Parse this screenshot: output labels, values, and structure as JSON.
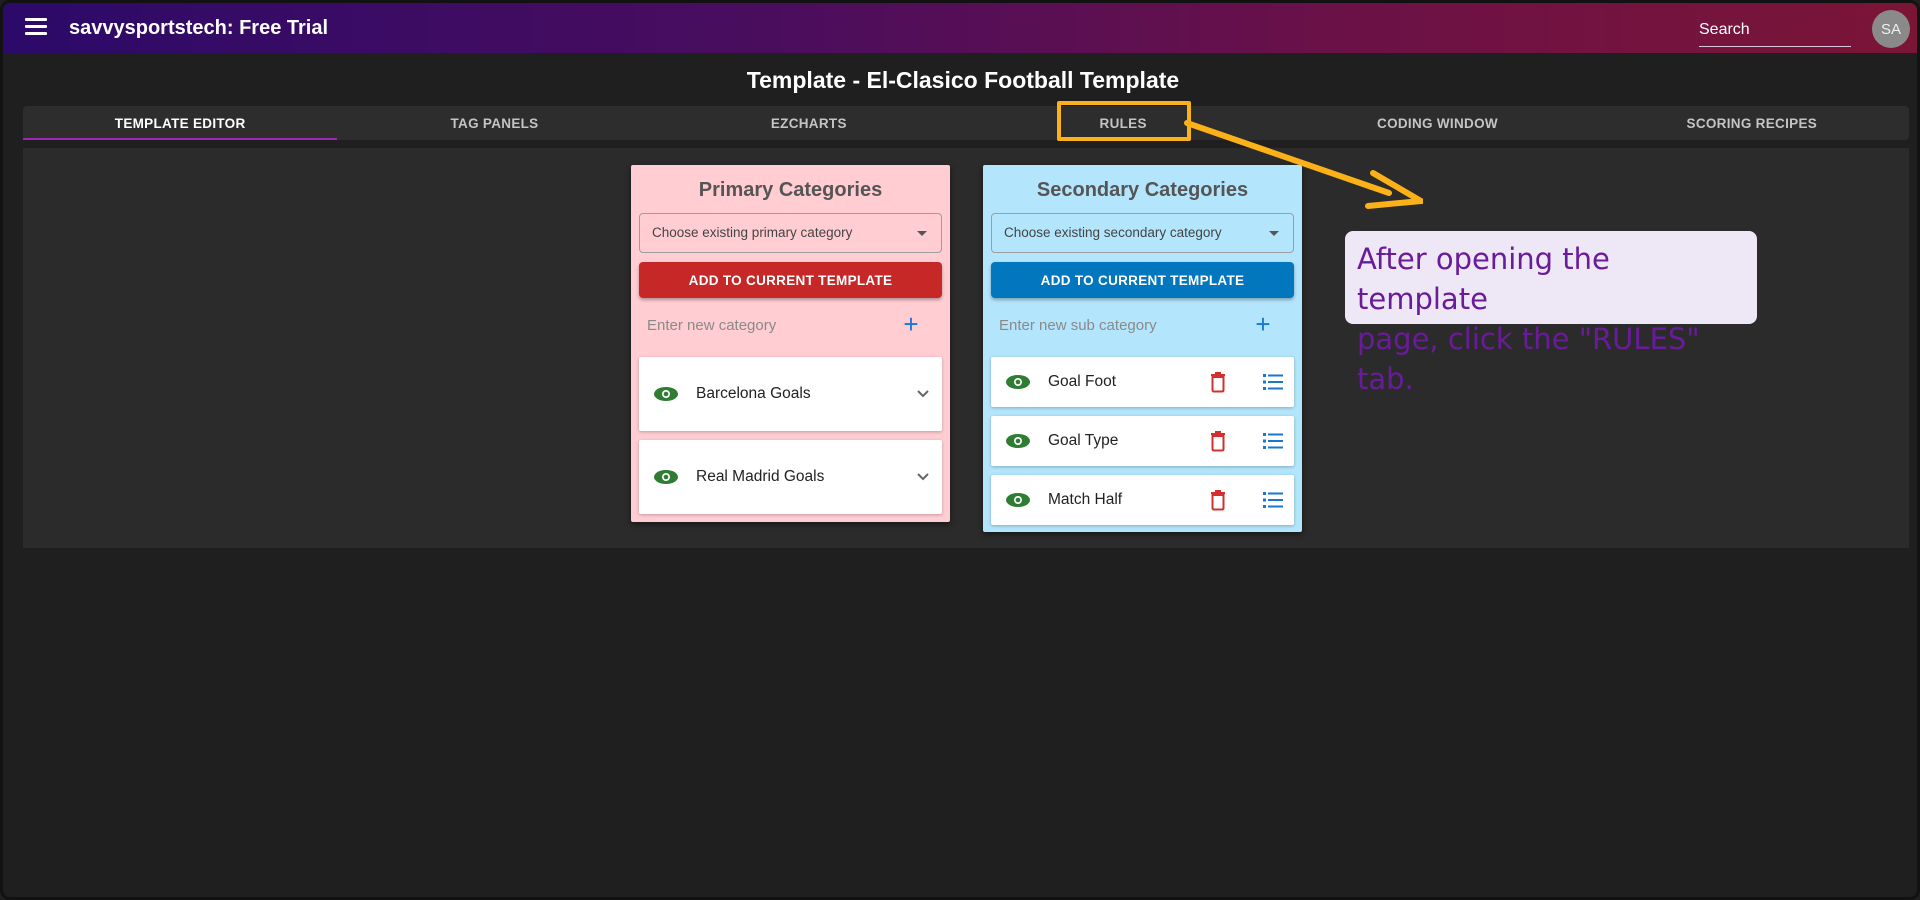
{
  "app": {
    "title": "savvysportstech: Free Trial",
    "search_placeholder": "Search",
    "avatar_initials": "SA"
  },
  "page": {
    "title": "Template - El-Clasico Football Template"
  },
  "tabs": [
    {
      "label": "TEMPLATE EDITOR",
      "active": true
    },
    {
      "label": "TAG PANELS"
    },
    {
      "label": "EZCHARTS"
    },
    {
      "label": "RULES"
    },
    {
      "label": "CODING WINDOW"
    },
    {
      "label": "SCORING RECIPES"
    }
  ],
  "primary": {
    "title": "Primary Categories",
    "select_placeholder": "Choose existing primary category",
    "add_label": "ADD TO CURRENT TEMPLATE",
    "new_placeholder": "Enter new category",
    "items": [
      {
        "label": "Barcelona Goals"
      },
      {
        "label": "Real Madrid Goals"
      }
    ]
  },
  "secondary": {
    "title": "Secondary Categories",
    "select_placeholder": "Choose existing secondary category",
    "add_label": "ADD TO CURRENT TEMPLATE",
    "new_placeholder": "Enter new sub category",
    "items": [
      {
        "label": "Goal Foot"
      },
      {
        "label": "Goal Type"
      },
      {
        "label": "Match Half"
      }
    ]
  },
  "annotation": {
    "line1": "After opening the template",
    "line2": "page, click the \"RULES\" tab.",
    "highlight_color": "#fbb117"
  },
  "colors": {
    "accent": "#9c27b0",
    "primary_button": "#c62828",
    "secondary_button": "#0277bd",
    "eye": "#2e7d32",
    "trash": "#d32f2f",
    "list": "#1976d2"
  }
}
